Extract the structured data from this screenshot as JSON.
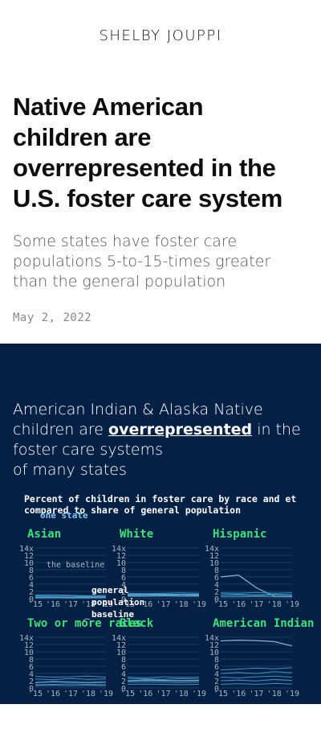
{
  "site": {
    "title": "SHELBY JOUPPI"
  },
  "article": {
    "headline": "Native American children are overrepresented in the U.S. foster care system",
    "headline_lines": [
      "Native American",
      "children are",
      "overrepresented in the",
      "U.S. foster care system"
    ],
    "subhead_lines": [
      "Some states have foster care",
      "populations 5-to-15-times greater",
      "than the general population"
    ],
    "date": "May 2, 2022"
  },
  "lede": {
    "part1": "American Indian & Alaska Native children are ",
    "emphasis": "overrepresented",
    "part2": " in the foster care systems",
    "part3": "of many states"
  },
  "colors": {
    "background_dark": "#042145",
    "panel_title": "#3be37a",
    "line": "#4aa3d8",
    "highlight_line": "#9dd1f0",
    "axis_text": "#a9b4c2",
    "grid": "#1d3a60",
    "annotation": "#ffffff",
    "one_state": "#7ec8f4"
  },
  "chart_data": {
    "type": "line",
    "title": "Percent of children in foster care by race and et compared to share of general population",
    "title_lines": [
      "Percent of children in foster care by race and et",
      "compared to share of general population"
    ],
    "annotations": {
      "one_state": "one state",
      "baseline_label": "the baseline",
      "general_population": [
        "general",
        "population",
        "baseline"
      ]
    },
    "y_ticks": [
      "14x",
      "12",
      "10",
      "8",
      "6",
      "4",
      "2",
      "0"
    ],
    "x_ticks": [
      "'15",
      "'16",
      "'17",
      "'18",
      "'19"
    ],
    "x": [
      2015,
      2016,
      2017,
      2018,
      2019
    ],
    "ylim": [
      0,
      14
    ],
    "grid": true,
    "panels": [
      {
        "name": "Asian",
        "series": [
          [
            0.3,
            0.3,
            0.3,
            0.3,
            0.3
          ],
          [
            0.5,
            0.5,
            0.4,
            0.5,
            0.5
          ],
          [
            0.2,
            0.3,
            0.2,
            0.2,
            0.3
          ],
          [
            0.8,
            0.7,
            0.7,
            0.6,
            0.6
          ],
          [
            1.0,
            1.1,
            0.9,
            0.8,
            0.9
          ]
        ]
      },
      {
        "name": "White",
        "series": [
          [
            1.0,
            1.0,
            1.1,
            1.0,
            1.0
          ],
          [
            0.8,
            0.9,
            0.8,
            0.9,
            0.8
          ],
          [
            1.3,
            1.2,
            1.3,
            1.2,
            1.3
          ],
          [
            0.6,
            0.6,
            0.7,
            0.6,
            0.6
          ],
          [
            1.5,
            1.4,
            1.5,
            1.6,
            1.5
          ]
        ]
      },
      {
        "name": "Hispanic",
        "series": [
          [
            6,
            6.5,
            3,
            0.6,
            0.6
          ],
          [
            0.8,
            0.9,
            0.8,
            1.0,
            0.9
          ],
          [
            1.3,
            1.2,
            1.1,
            1.2,
            1.1
          ],
          [
            0.5,
            0.5,
            0.6,
            0.5,
            0.5
          ],
          [
            1.6,
            1.5,
            1.7,
            1.5,
            1.6
          ]
        ]
      },
      {
        "name": "Two or more races",
        "series": [
          [
            1.5,
            1.7,
            1.6,
            1.5,
            1.6
          ],
          [
            2.5,
            2.3,
            2.6,
            2.4,
            2.5
          ],
          [
            0.9,
            1.0,
            1.1,
            1.0,
            0.9
          ],
          [
            3.2,
            3.0,
            3.1,
            3.3,
            3.0
          ],
          [
            0.6,
            0.7,
            0.6,
            0.7,
            0.6
          ]
        ]
      },
      {
        "name": "Black",
        "series": [
          [
            2.0,
            2.2,
            2.1,
            2.0,
            2.1
          ],
          [
            3.0,
            2.8,
            3.1,
            2.9,
            3.0
          ],
          [
            1.6,
            1.7,
            1.6,
            1.5,
            1.6
          ],
          [
            1.0,
            1.1,
            1.0,
            0.9,
            1.0
          ],
          [
            2.6,
            2.5,
            2.4,
            2.6,
            2.5
          ]
        ]
      },
      {
        "name": "American Indian",
        "series": [
          [
            13,
            13.2,
            13.1,
            12.8,
            11.6
          ],
          [
            5,
            5.2,
            5.5,
            5.3,
            5.6
          ],
          [
            4,
            4.3,
            4.0,
            4.5,
            4.2
          ],
          [
            3,
            2.8,
            3.1,
            3.3,
            3.0
          ],
          [
            2,
            2.2,
            1.9,
            2.4,
            2.1
          ],
          [
            1,
            1.2,
            1.0,
            1.3,
            1.1
          ]
        ]
      }
    ]
  }
}
